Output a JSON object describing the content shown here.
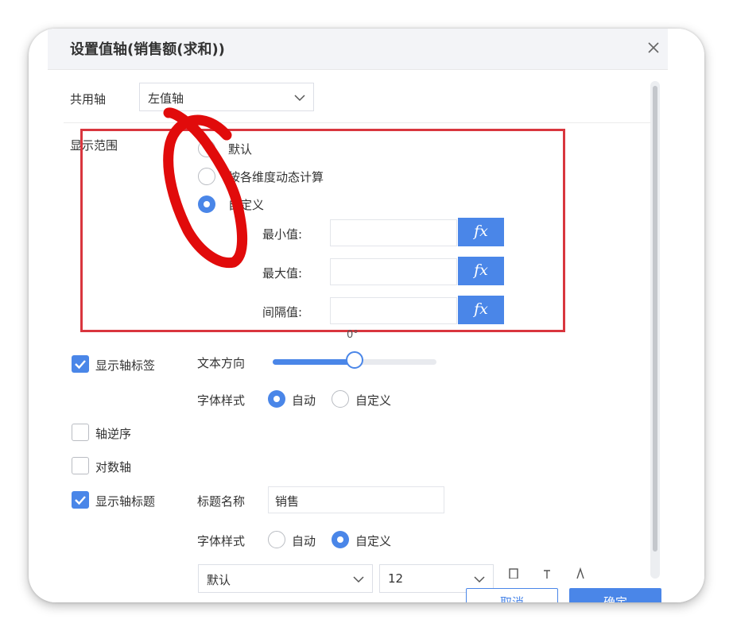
{
  "dialog": {
    "title": "设置值轴(销售额(求和))",
    "close_icon": "close-icon"
  },
  "shared_axis": {
    "label": "共用轴",
    "value": "左值轴"
  },
  "display_range": {
    "label": "显示范围",
    "options": [
      {
        "label": "默认",
        "selected": false
      },
      {
        "label": "按各维度动态计算",
        "selected": false
      },
      {
        "label": "自定义",
        "selected": true
      }
    ],
    "min_label": "最小值:",
    "max_label": "最大值:",
    "interval_label": "间隔值:",
    "min_value": "",
    "max_value": "",
    "interval_value": "",
    "fx_label": "fx"
  },
  "axis_labels": {
    "checkbox_label": "显示轴标签",
    "checked": true,
    "text_direction_label": "文本方向",
    "text_direction_value": "0°",
    "slider_fraction": 0.5,
    "font_style_label": "字体样式",
    "font_options": [
      {
        "label": "自动",
        "selected": true
      },
      {
        "label": "自定义",
        "selected": false
      }
    ]
  },
  "axis_reverse": {
    "label": "轴逆序",
    "checked": false
  },
  "log_axis": {
    "label": "对数轴",
    "checked": false
  },
  "axis_title": {
    "checkbox_label": "显示轴标题",
    "checked": true,
    "title_name_label": "标题名称",
    "title_name_value": "销售",
    "font_style_label": "字体样式",
    "font_options": [
      {
        "label": "自动",
        "selected": false
      },
      {
        "label": "自定义",
        "selected": true
      }
    ],
    "font_family_value": "默认",
    "font_size_value": "12"
  },
  "footer": {
    "cancel_label": "取消",
    "ok_label": "确定"
  },
  "colors": {
    "accent": "#4a86e8",
    "annotation_red": "#e10b0b"
  }
}
